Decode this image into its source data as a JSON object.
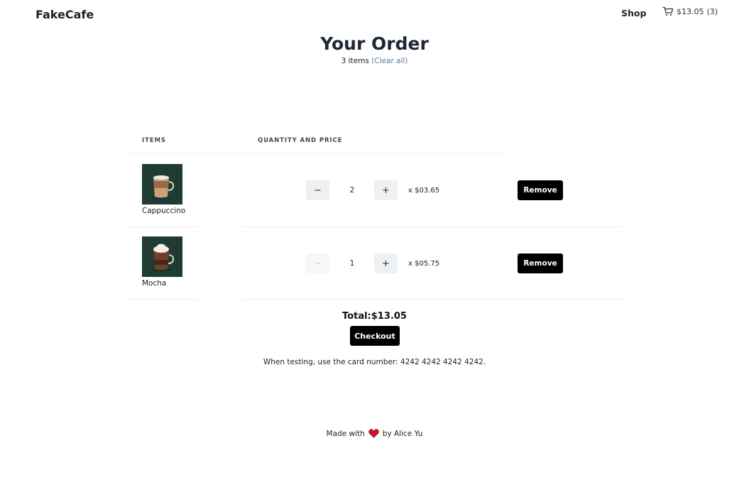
{
  "header": {
    "brand": "FakeCafe",
    "nav_shop": "Shop",
    "cart_total": "$13.05",
    "cart_count": "(3)",
    "icon": "cart-icon"
  },
  "order": {
    "title": "Your Order",
    "item_count": "3 items",
    "clear_all": "(Clear all)"
  },
  "table": {
    "headers": [
      "ITEMS",
      "QUANTITY AND PRICE"
    ],
    "rows": [
      {
        "name": "Cappuccino",
        "quantity": "2",
        "price": "x $03.65",
        "remove_label": "Remove",
        "decrement_label": "−",
        "increment_label": "+",
        "decrement_enabled": true
      },
      {
        "name": "Mocha",
        "quantity": "1",
        "price": "x $05.75",
        "remove_label": "Remove",
        "decrement_label": "−",
        "increment_label": "+",
        "decrement_enabled": false
      }
    ]
  },
  "summary": {
    "total": "Total:$13.05",
    "checkout_label": "Checkout",
    "test_note": "When testing, use the card number: 4242 4242 4242 4242."
  },
  "footer": {
    "made_with": "Made with",
    "by": "by Alice Yu",
    "icon": "heart-icon"
  },
  "colors": {
    "accent_link": "#5b7a99",
    "button_dark": "#000000",
    "stepper_bg": "#eef1f4",
    "thumb_bg": "#1f3b33",
    "heart": "#d0102a"
  }
}
